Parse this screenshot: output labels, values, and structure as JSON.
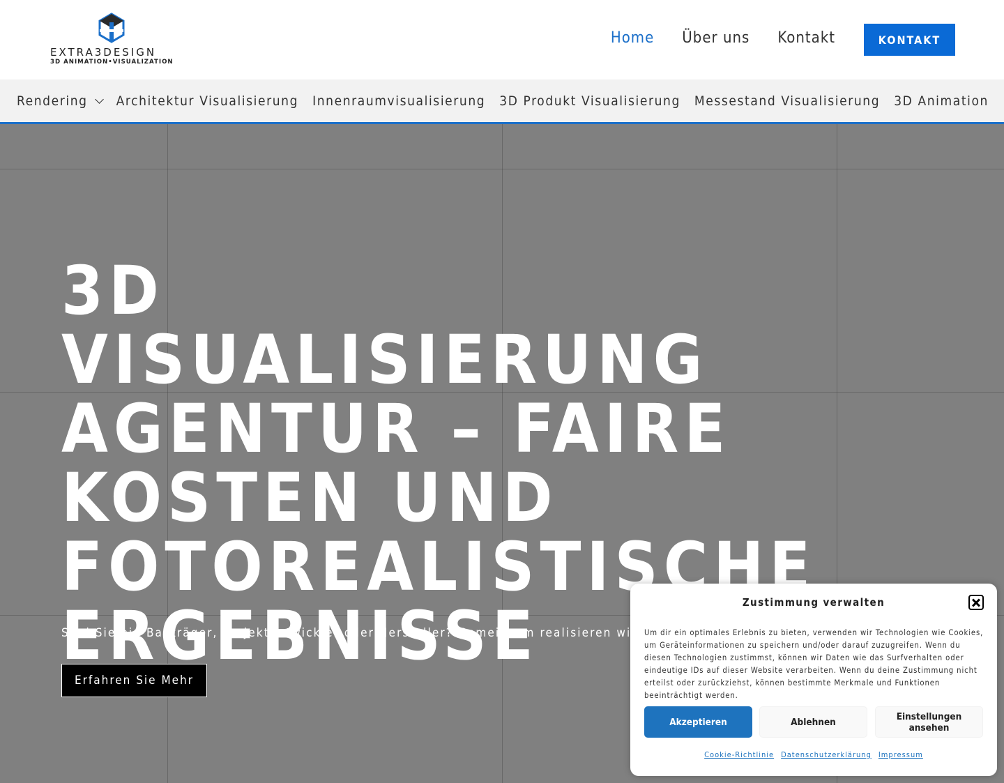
{
  "brand": {
    "name": "EXTRA3DESIGN",
    "tagline": "3D ANIMATION•VISUALIZATION",
    "accent_color": "#1b6fc9",
    "button_color": "#0a6ad6"
  },
  "main_nav": {
    "items": [
      "Home",
      "Über uns",
      "Kontakt"
    ],
    "active_index": 0,
    "cta_label": "KONTAKT"
  },
  "sub_nav": {
    "items": [
      "Rendering",
      "Architektur Visualisierung",
      "Innenraumvisualisierung",
      "3D Produkt Visualisierung",
      "Messestand Visualisierung",
      "3D Animation"
    ]
  },
  "hero": {
    "title": "3D Visualisierung Agentur – Faire Kosten und Fotorealistische Ergebnisse",
    "subtitle": "Sind Sie ein Bauträger, Projektentwickler oder Hersteller? Gemeinsam realisieren wir Ihre Vision.",
    "cta_label": "Erfahren Sie Mehr",
    "background_color": "#808080"
  },
  "cookie_banner": {
    "title": "Zustimmung verwalten",
    "text": "Um dir ein optimales Erlebnis zu bieten, verwenden wir Technologien wie Cookies, um Geräteinformationen zu speichern und/oder darauf zuzugreifen. Wenn du diesen Technologien zustimmst, können wir Daten wie das Surfverhalten oder eindeutige IDs auf dieser Website verarbeiten. Wenn du deine Zustimmung nicht erteilst oder zurückziehst, können bestimmte Merkmale und Funktionen beeinträchtigt werden.",
    "accept_label": "Akzeptieren",
    "deny_label": "Ablehnen",
    "settings_label": "Einstellungen ansehen",
    "links": [
      "Cookie-Richtlinie",
      "Datenschutzerklärung",
      "Impressum"
    ],
    "close_icon": "close-icon"
  }
}
